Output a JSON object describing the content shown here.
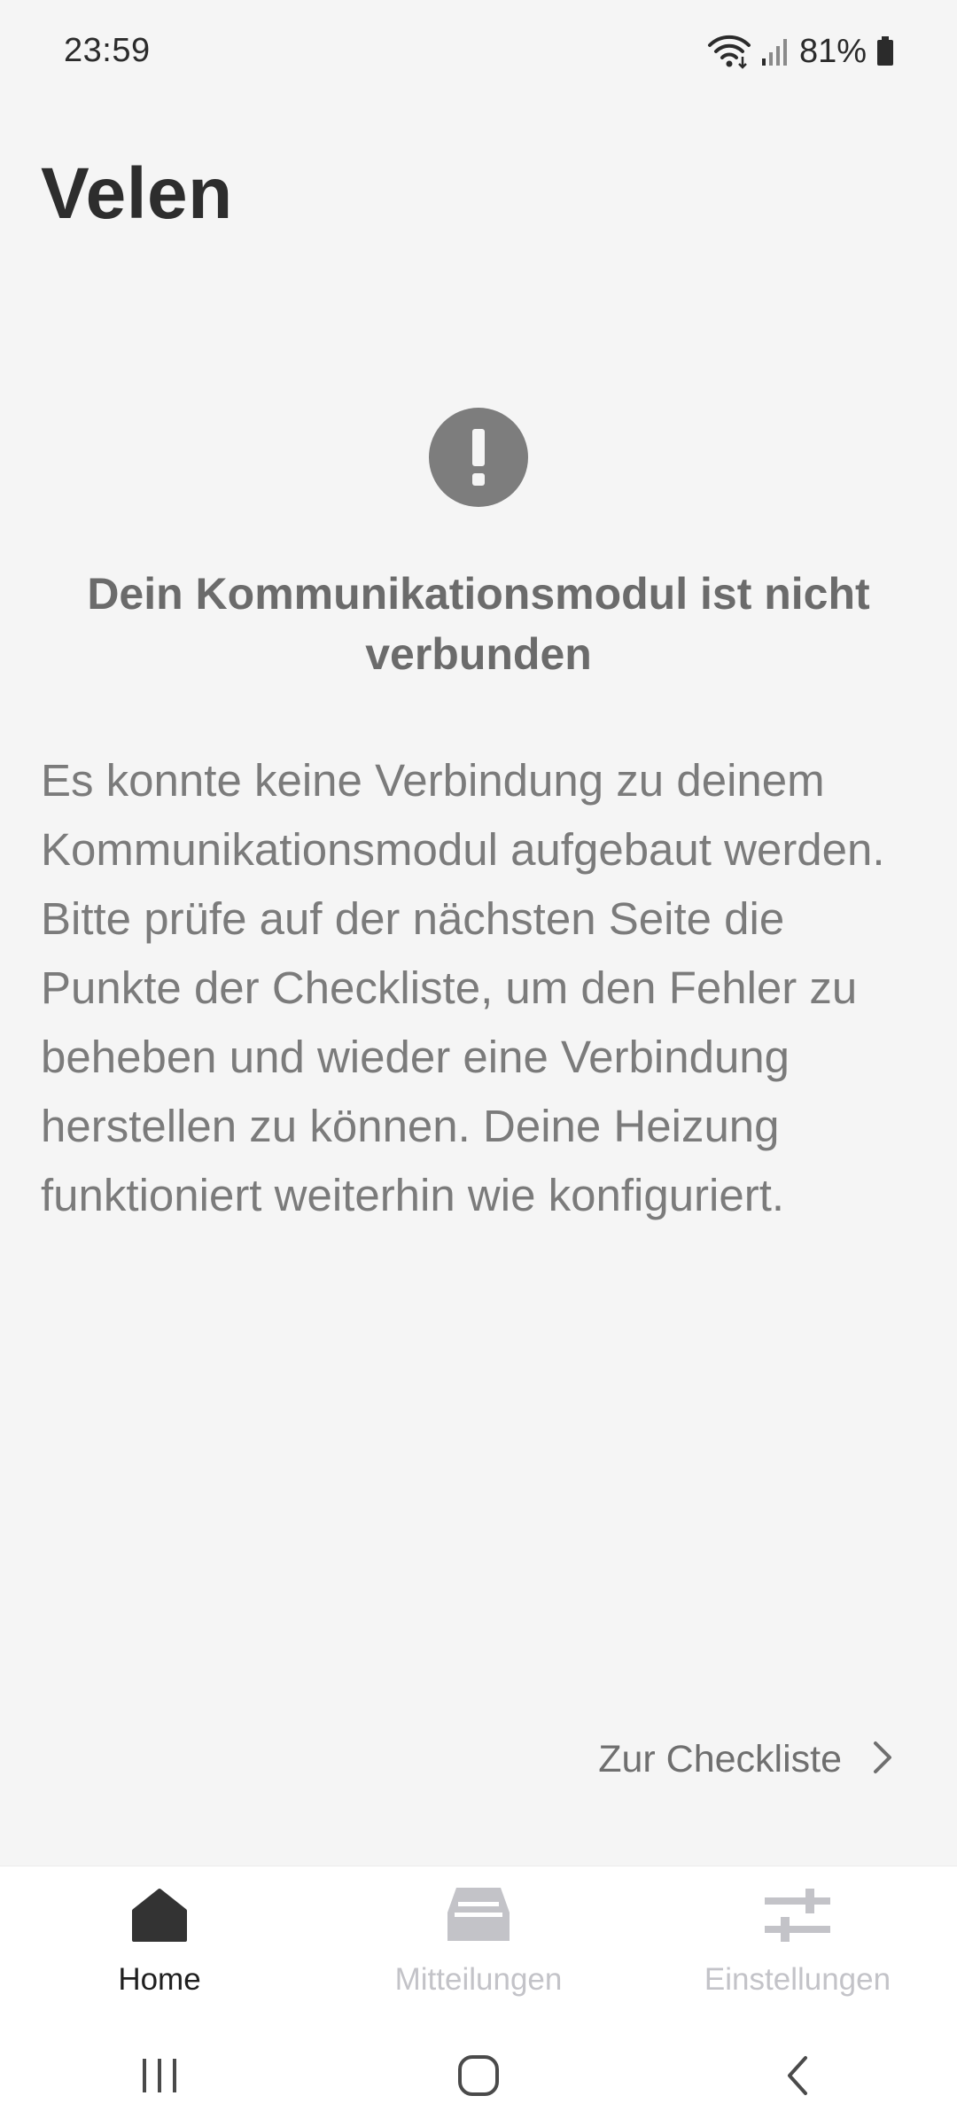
{
  "status_bar": {
    "time": "23:59",
    "battery_percent": "81%",
    "icons": [
      "wifi-icon",
      "signal-icon",
      "battery-icon"
    ]
  },
  "app": {
    "title": "Velen"
  },
  "alert": {
    "icon": "exclamation-icon",
    "title": "Dein Kommunikationsmodul ist nicht verbunden",
    "body": "Es konnte keine Verbindung zu deinem Kommunikationsmodul aufgebaut werden. Bitte prüfe auf der nächsten Seite die Punkte der Checkliste, um den Fehler zu beheben und wieder eine Verbindung herstellen zu können. Deine Heizung funktioniert weiterhin wie konfiguriert."
  },
  "checklist_link": {
    "label": "Zur Checkliste",
    "icon": "chevron-right-icon"
  },
  "bottom_nav": {
    "items": [
      {
        "label": "Home",
        "icon": "home-icon",
        "active": true
      },
      {
        "label": "Mitteilungen",
        "icon": "inbox-icon",
        "active": false
      },
      {
        "label": "Einstellungen",
        "icon": "sliders-icon",
        "active": false
      }
    ]
  },
  "system_nav": {
    "buttons": [
      "recent-apps-icon",
      "home-circle-icon",
      "back-icon"
    ]
  },
  "colors": {
    "background": "#f5f5f5",
    "alert_icon": "#7d7d7d",
    "nav_active": "#333333",
    "nav_inactive": "#c3c3c8"
  }
}
